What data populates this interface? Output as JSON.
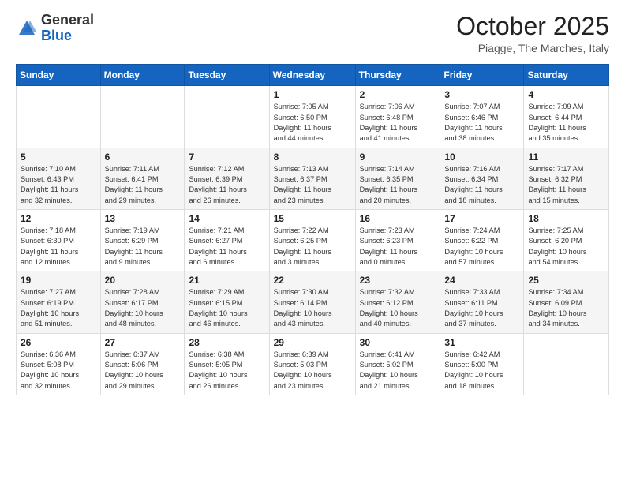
{
  "header": {
    "logo_general": "General",
    "logo_blue": "Blue",
    "month_title": "October 2025",
    "subtitle": "Piagge, The Marches, Italy"
  },
  "days_of_week": [
    "Sunday",
    "Monday",
    "Tuesday",
    "Wednesday",
    "Thursday",
    "Friday",
    "Saturday"
  ],
  "weeks": [
    [
      {
        "day": "",
        "info": ""
      },
      {
        "day": "",
        "info": ""
      },
      {
        "day": "",
        "info": ""
      },
      {
        "day": "1",
        "info": "Sunrise: 7:05 AM\nSunset: 6:50 PM\nDaylight: 11 hours\nand 44 minutes."
      },
      {
        "day": "2",
        "info": "Sunrise: 7:06 AM\nSunset: 6:48 PM\nDaylight: 11 hours\nand 41 minutes."
      },
      {
        "day": "3",
        "info": "Sunrise: 7:07 AM\nSunset: 6:46 PM\nDaylight: 11 hours\nand 38 minutes."
      },
      {
        "day": "4",
        "info": "Sunrise: 7:09 AM\nSunset: 6:44 PM\nDaylight: 11 hours\nand 35 minutes."
      }
    ],
    [
      {
        "day": "5",
        "info": "Sunrise: 7:10 AM\nSunset: 6:43 PM\nDaylight: 11 hours\nand 32 minutes."
      },
      {
        "day": "6",
        "info": "Sunrise: 7:11 AM\nSunset: 6:41 PM\nDaylight: 11 hours\nand 29 minutes."
      },
      {
        "day": "7",
        "info": "Sunrise: 7:12 AM\nSunset: 6:39 PM\nDaylight: 11 hours\nand 26 minutes."
      },
      {
        "day": "8",
        "info": "Sunrise: 7:13 AM\nSunset: 6:37 PM\nDaylight: 11 hours\nand 23 minutes."
      },
      {
        "day": "9",
        "info": "Sunrise: 7:14 AM\nSunset: 6:35 PM\nDaylight: 11 hours\nand 20 minutes."
      },
      {
        "day": "10",
        "info": "Sunrise: 7:16 AM\nSunset: 6:34 PM\nDaylight: 11 hours\nand 18 minutes."
      },
      {
        "day": "11",
        "info": "Sunrise: 7:17 AM\nSunset: 6:32 PM\nDaylight: 11 hours\nand 15 minutes."
      }
    ],
    [
      {
        "day": "12",
        "info": "Sunrise: 7:18 AM\nSunset: 6:30 PM\nDaylight: 11 hours\nand 12 minutes."
      },
      {
        "day": "13",
        "info": "Sunrise: 7:19 AM\nSunset: 6:29 PM\nDaylight: 11 hours\nand 9 minutes."
      },
      {
        "day": "14",
        "info": "Sunrise: 7:21 AM\nSunset: 6:27 PM\nDaylight: 11 hours\nand 6 minutes."
      },
      {
        "day": "15",
        "info": "Sunrise: 7:22 AM\nSunset: 6:25 PM\nDaylight: 11 hours\nand 3 minutes."
      },
      {
        "day": "16",
        "info": "Sunrise: 7:23 AM\nSunset: 6:23 PM\nDaylight: 11 hours\nand 0 minutes."
      },
      {
        "day": "17",
        "info": "Sunrise: 7:24 AM\nSunset: 6:22 PM\nDaylight: 10 hours\nand 57 minutes."
      },
      {
        "day": "18",
        "info": "Sunrise: 7:25 AM\nSunset: 6:20 PM\nDaylight: 10 hours\nand 54 minutes."
      }
    ],
    [
      {
        "day": "19",
        "info": "Sunrise: 7:27 AM\nSunset: 6:19 PM\nDaylight: 10 hours\nand 51 minutes."
      },
      {
        "day": "20",
        "info": "Sunrise: 7:28 AM\nSunset: 6:17 PM\nDaylight: 10 hours\nand 48 minutes."
      },
      {
        "day": "21",
        "info": "Sunrise: 7:29 AM\nSunset: 6:15 PM\nDaylight: 10 hours\nand 46 minutes."
      },
      {
        "day": "22",
        "info": "Sunrise: 7:30 AM\nSunset: 6:14 PM\nDaylight: 10 hours\nand 43 minutes."
      },
      {
        "day": "23",
        "info": "Sunrise: 7:32 AM\nSunset: 6:12 PM\nDaylight: 10 hours\nand 40 minutes."
      },
      {
        "day": "24",
        "info": "Sunrise: 7:33 AM\nSunset: 6:11 PM\nDaylight: 10 hours\nand 37 minutes."
      },
      {
        "day": "25",
        "info": "Sunrise: 7:34 AM\nSunset: 6:09 PM\nDaylight: 10 hours\nand 34 minutes."
      }
    ],
    [
      {
        "day": "26",
        "info": "Sunrise: 6:36 AM\nSunset: 5:08 PM\nDaylight: 10 hours\nand 32 minutes."
      },
      {
        "day": "27",
        "info": "Sunrise: 6:37 AM\nSunset: 5:06 PM\nDaylight: 10 hours\nand 29 minutes."
      },
      {
        "day": "28",
        "info": "Sunrise: 6:38 AM\nSunset: 5:05 PM\nDaylight: 10 hours\nand 26 minutes."
      },
      {
        "day": "29",
        "info": "Sunrise: 6:39 AM\nSunset: 5:03 PM\nDaylight: 10 hours\nand 23 minutes."
      },
      {
        "day": "30",
        "info": "Sunrise: 6:41 AM\nSunset: 5:02 PM\nDaylight: 10 hours\nand 21 minutes."
      },
      {
        "day": "31",
        "info": "Sunrise: 6:42 AM\nSunset: 5:00 PM\nDaylight: 10 hours\nand 18 minutes."
      },
      {
        "day": "",
        "info": ""
      }
    ]
  ]
}
